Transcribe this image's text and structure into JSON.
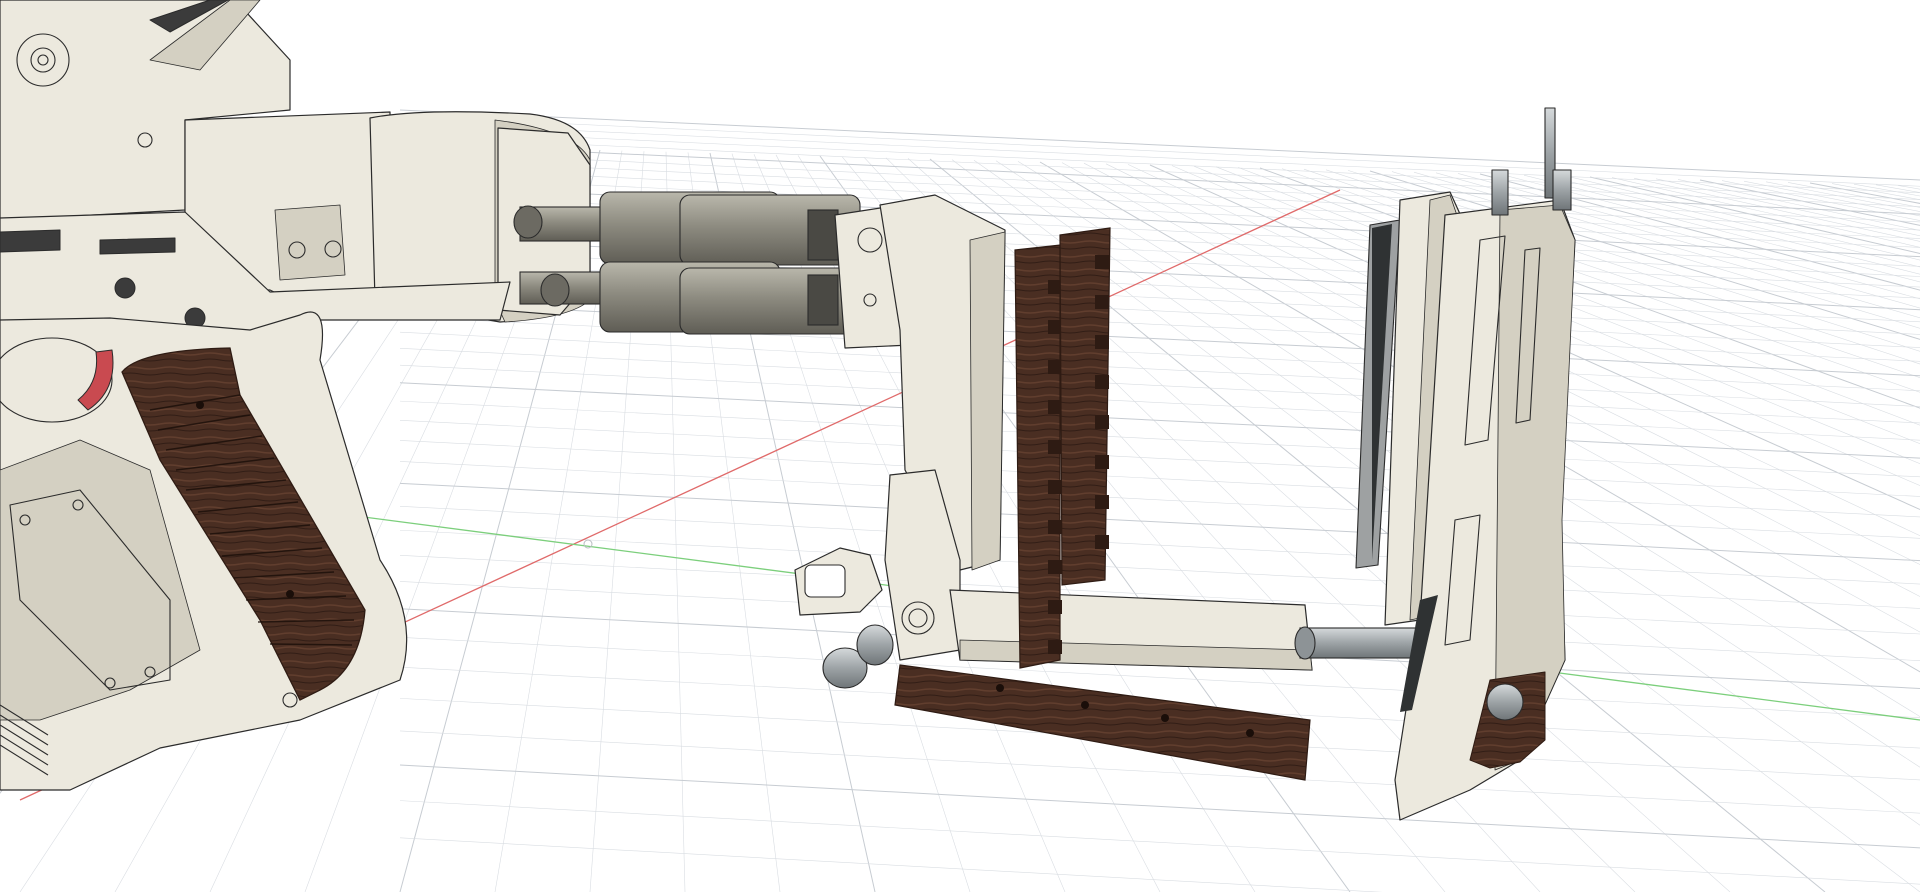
{
  "viewport": {
    "background_color": "#ffffff",
    "grid_color": "#d9dde2",
    "grid_major_color": "#c7ccd2",
    "x_axis_color": "#e06a6a",
    "y_axis_color": "#7ccf7c"
  },
  "model": {
    "body_color": "#ece9de",
    "body_shadow_color": "#d4d0c2",
    "outline_color": "#2b2b2b",
    "dark_trim_color": "#3b3b3b",
    "wood_color": "#4a2e22",
    "wood_dark_color": "#2e1b13",
    "metal_color": "#8d8b80",
    "metal_dark_color": "#5f5d55",
    "trigger_color": "#c94a50",
    "rod_color": "#9da3a6"
  }
}
